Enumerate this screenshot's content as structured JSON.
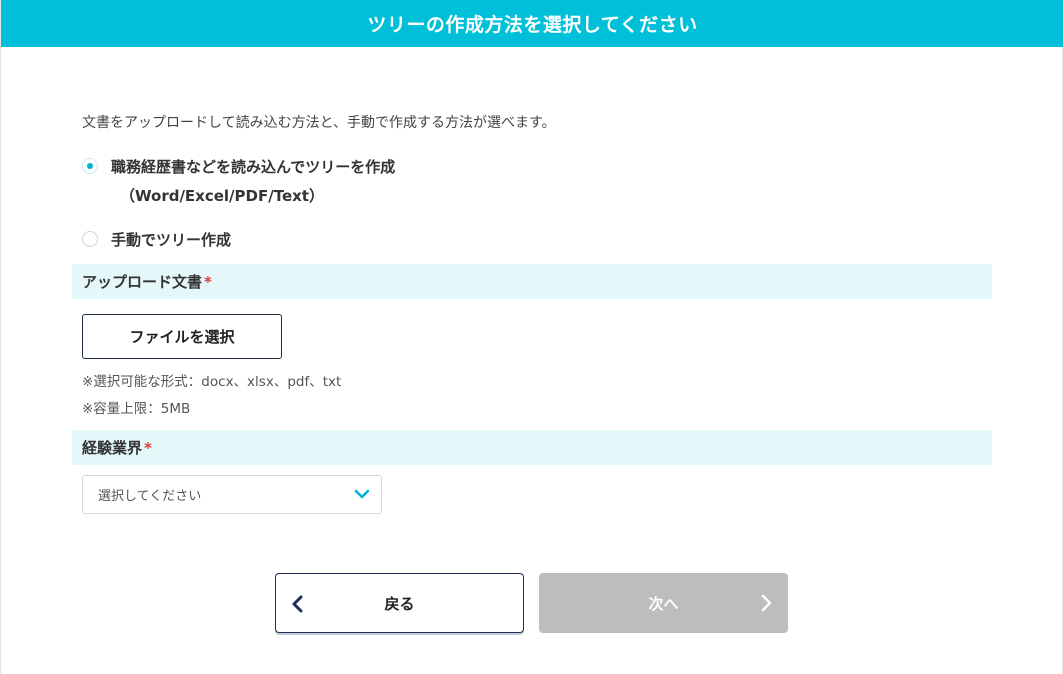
{
  "header": {
    "title": "ツリーの作成方法を選択してください"
  },
  "description": "文書をアップロードして読み込む方法と、手動で作成する方法が選べます。",
  "method_options": [
    {
      "label": "職務経歴書などを読み込んでツリーを作成",
      "sublabel": "（Word/Excel/PDF/Text）",
      "selected": true
    },
    {
      "label": "手動でツリー作成",
      "selected": false
    }
  ],
  "upload_section": {
    "title": "アップロード文書",
    "required_mark": "*",
    "file_button_label": "ファイルを選択",
    "note_formats": "※選択可能な形式：docx、xlsx、pdf、txt",
    "note_size": "※容量上限：5MB"
  },
  "industry_section": {
    "title": "経験業界",
    "required_mark": "*",
    "select_value": "選択してください"
  },
  "footer": {
    "back_label": "戻る",
    "next_label": "次へ",
    "next_enabled": false
  },
  "colors": {
    "header_bg": "#00c0d9",
    "section_bg": "#e4f7f9",
    "accent": "#00b4cc",
    "required": "#e53935",
    "disabled_button": "#bdbdbd"
  },
  "icons": {
    "select_chevron": "chevron-down-icon",
    "back": "chevron-left-icon",
    "next": "chevron-right-icon"
  }
}
